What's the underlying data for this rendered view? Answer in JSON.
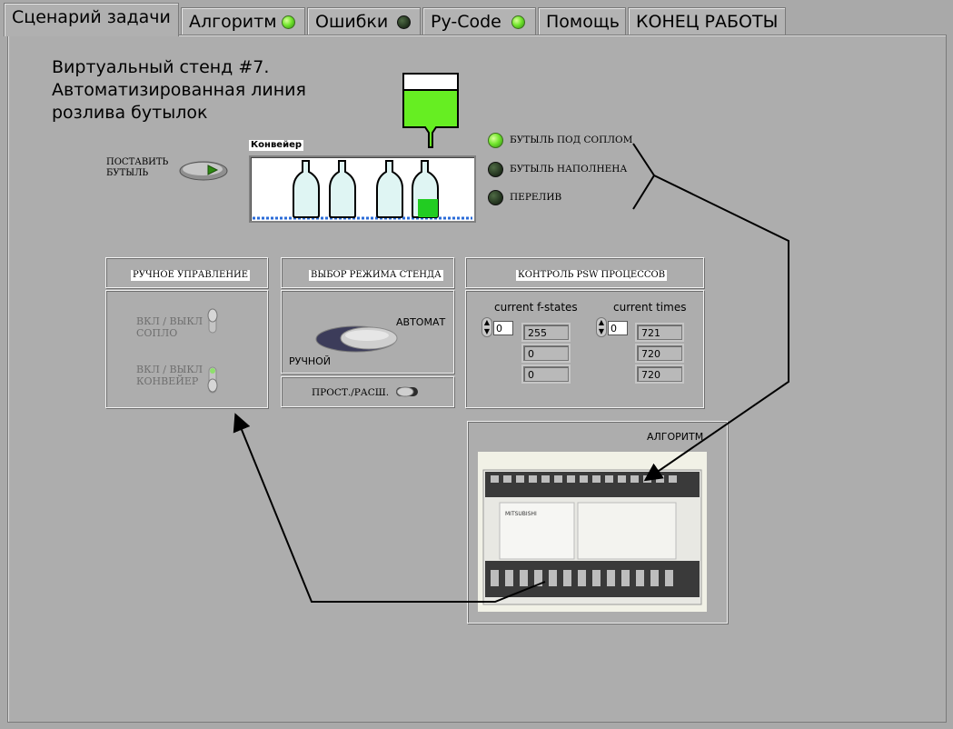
{
  "tabs": [
    {
      "label": "Сценарий задачи",
      "led": null
    },
    {
      "label": "Алгоритм",
      "led": "on"
    },
    {
      "label": "Ошибки",
      "led": "off"
    },
    {
      "label": "Py-Code",
      "led": "on"
    },
    {
      "label": "Помощь",
      "led": null
    },
    {
      "label": "КОНЕЦ РАБОТЫ",
      "led": null
    }
  ],
  "title": {
    "line1": "Виртуальный стенд #7.",
    "line2": "Автоматизированная  линия",
    "line3": "розлива бутылок"
  },
  "put_bottle": {
    "line1": "ПОСТАВИТЬ",
    "line2": "БУТЫЛЬ"
  },
  "conveyor": {
    "label": "Конвейер"
  },
  "indicators": [
    {
      "label": "БУТЫЛЬ ПОД СОПЛОМ",
      "state": "on"
    },
    {
      "label": "БУТЫЛЬ НАПОЛНЕНА",
      "state": "off"
    },
    {
      "label": "ПЕРЕЛИВ",
      "state": "off"
    }
  ],
  "manual": {
    "header": "РУЧНОЕ УПРАВЛЕНИЕ",
    "nozzle": {
      "line1": "ВКЛ / ВЫКЛ",
      "line2": "СОПЛО"
    },
    "conveyor": {
      "line1": "ВКЛ / ВЫКЛ",
      "line2": "КОНВЕЙЕР"
    }
  },
  "mode": {
    "header": "ВЫБОР РЕЖИМА СТЕНДА",
    "auto": "АВТОМАТ",
    "manual": "РУЧНОЙ",
    "simple": "ПРОСТ./РАСШ."
  },
  "psw": {
    "header": "КОНТРОЛЬ PSW ПРОЦЕССОВ",
    "fstates": {
      "label": "current f-states",
      "index": "0",
      "values": [
        "255",
        "0",
        "0"
      ]
    },
    "times": {
      "label": "current times",
      "index": "0",
      "values": [
        "721",
        "720",
        "720"
      ]
    }
  },
  "algorithm": {
    "label": "АЛГОРИТМ",
    "brand": "MITSUBISHI"
  },
  "colors": {
    "led_on": "#73e62e",
    "liquid": "#66ee22",
    "bottle": "#dff5f3"
  }
}
